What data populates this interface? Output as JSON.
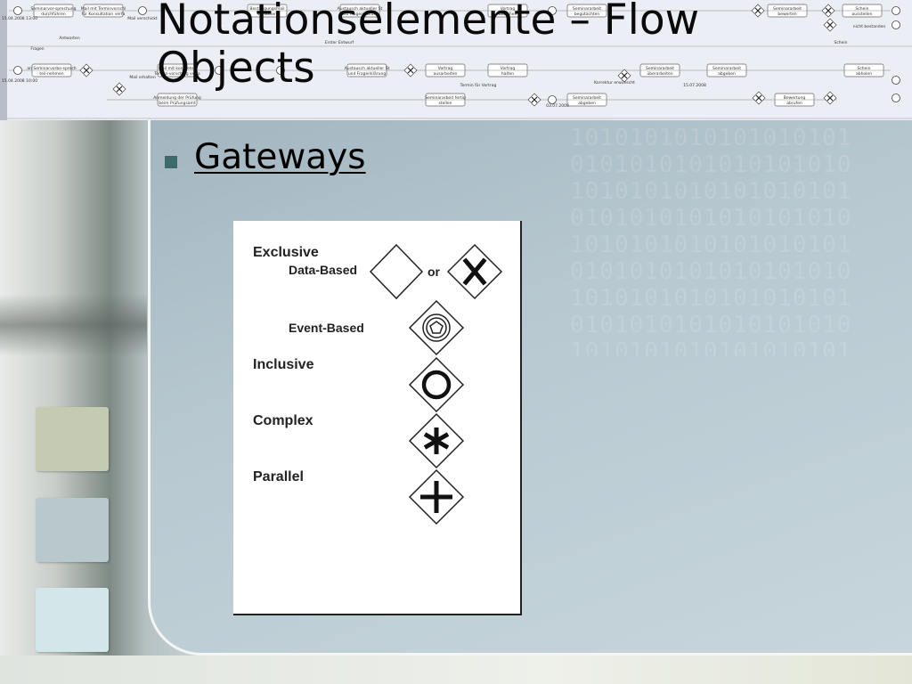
{
  "slide": {
    "title": "Notationselemente – Flow Objects",
    "bullet": "Gateways"
  },
  "banner": {
    "tasks_row1": [
      "Seminarvor-sprechung durchführen",
      "Mail mit Terminvorschlägen für Konsultation verfassen",
      "Bestätigungsmail verfassen",
      "Austausch aktueller Stand und Fragenklärung",
      "Vortrag tauschen",
      "Seminararbeit begutachten",
      "Seminararbeit bewerten",
      "Schein ausstellen"
    ],
    "tasks_row2": [
      "an Seminarvorbe-sprechung teil-nehmen",
      "Mail mit konkreten Termin-vorschlag verfassen",
      "Austausch aktueller Stand und Fragenklärung",
      "Vortrag ausarbeiten",
      "Vortrag halten",
      "Seminararbeit überarbeiten",
      "Seminararbeit abgeben",
      "Schein abholen"
    ],
    "tasks_row3": [
      "Anmeldung der Prüfung beim Prüfungsamt",
      "Seminararbeit fertig stellen",
      "Seminararbeit abgeben",
      "Bewertung abrufen"
    ],
    "labels": [
      "15.04.2008 13:00",
      "15.04.2008 10:00",
      "Mail verschickt",
      "Mail erhalten",
      "Antworten",
      "Fragen",
      "Erster Entwurf",
      "Termin für Vortrag",
      "03.07.2008",
      "15.07.2008",
      "Korrektur erwünscht",
      "nicht bestanden",
      "Schein"
    ]
  },
  "figure": {
    "labels": {
      "exclusive": "Exclusive",
      "data_based": "Data-Based",
      "or": "or",
      "event_based": "Event-Based",
      "inclusive": "Inclusive",
      "complex": "Complex",
      "parallel": "Parallel"
    },
    "symbols": [
      "diamond-empty",
      "diamond-x",
      "diamond-pentagon",
      "diamond-circle",
      "diamond-asterisk",
      "diamond-plus"
    ]
  },
  "colors": {
    "bullet": "#3d6b6b",
    "side_square_1": "#c5cbb2",
    "side_square_2": "#b9c8cc",
    "side_square_3": "#d3e6ea"
  }
}
